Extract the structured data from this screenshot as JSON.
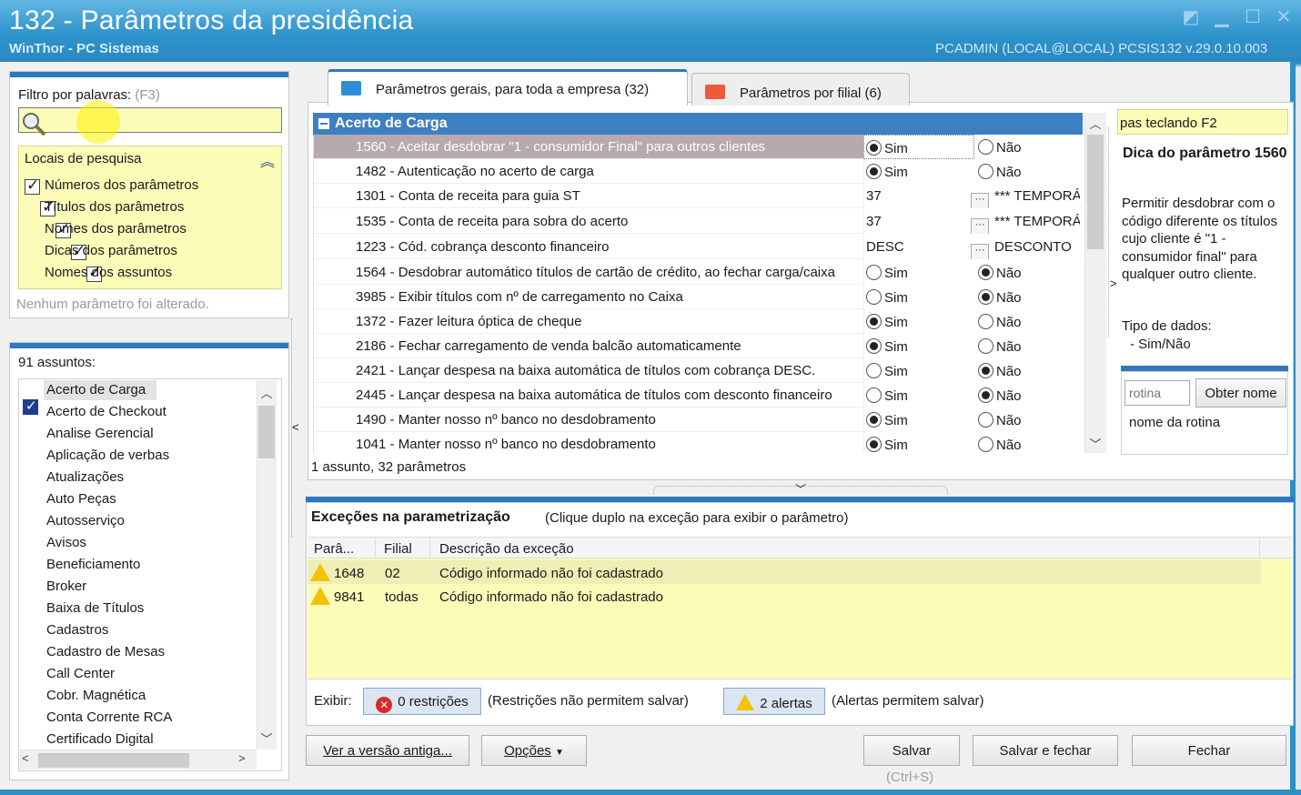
{
  "window": {
    "title": "132 - Parâmetros da presidência",
    "subtitle": "WinThor - PC Sistemas",
    "user_info": "PCADMIN (LOCAL@LOCAL)   PCSIS132  v.29.0.10.003"
  },
  "filter": {
    "label": "Filtro por palavras:",
    "shortcut": "(F3)",
    "value": "",
    "locations_title": "Locais de pesquisa",
    "options": [
      {
        "label": "Números dos parâmetros",
        "checked": true
      },
      {
        "label": "Títulos dos parâmetros",
        "checked": true
      },
      {
        "label": "Nomes dos parâmetros",
        "checked": true
      },
      {
        "label": "Dicas dos parâmetros",
        "checked": true
      },
      {
        "label": "Nomes dos assuntos",
        "checked": true
      }
    ],
    "status": "Nenhum parâmetro foi alterado."
  },
  "subjects": {
    "count_label": "91 assuntos:",
    "items": [
      "Acerto de Carga",
      "Acerto de Checkout",
      "Analise Gerencial",
      "Aplicação de verbas",
      "Atualizações",
      "Auto Peças",
      "Autosserviço",
      "Avisos",
      "Beneficiamento",
      "Broker",
      "Baixa de Títulos",
      "Cadastros",
      "Cadastro de Mesas",
      "Call Center",
      "Cobr. Magnética",
      "Conta Corrente RCA",
      "Certificado Digital"
    ]
  },
  "tabs": [
    {
      "label": "Parâmetros gerais, para toda a empresa  (32)",
      "active": true,
      "color": "#2d8ed8"
    },
    {
      "label": "Parâmetros por filial  (6)",
      "active": false,
      "color": "#ee5a3c"
    }
  ],
  "grid": {
    "group": "Acerto de Carga",
    "rows": [
      {
        "name": "1560 - Aceitar desdobrar \"1 - consumidor Final\" para outros clientes",
        "type": "bool",
        "value": true
      },
      {
        "name": "1482 - Autenticação no acerto de carga",
        "type": "bool",
        "value": true
      },
      {
        "name": "1301 - Conta de receita para guia ST",
        "type": "lookup",
        "code": "37",
        "desc": "*** TEMPORÁRIO"
      },
      {
        "name": "1535 - Conta de receita para sobra do acerto",
        "type": "lookup",
        "code": "37",
        "desc": "*** TEMPORÁRIO"
      },
      {
        "name": "1223 - Cód. cobrança desconto financeiro",
        "type": "lookup",
        "code": "DESC",
        "desc": "DESCONTO"
      },
      {
        "name": "1564 - Desdobrar automático títulos de cartão de crédito, ao fechar carga/caixa",
        "type": "bool",
        "value": false
      },
      {
        "name": "3985 - Exibir títulos com nº de carregamento no Caixa",
        "type": "bool",
        "value": false
      },
      {
        "name": "1372 - Fazer leitura óptica de cheque",
        "type": "bool",
        "value": true
      },
      {
        "name": "2186 - Fechar carregamento de venda balcão automaticamente",
        "type": "bool",
        "value": true
      },
      {
        "name": "2421 - Lançar despesa na baixa automática de títulos com cobrança DESC.",
        "type": "bool",
        "value": false
      },
      {
        "name": "2445 - Lançar despesa na baixa automática de títulos com desconto financeiro",
        "type": "bool",
        "value": false
      },
      {
        "name": "1490 - Manter nosso nº banco no desdobramento",
        "type": "bool",
        "value": true
      },
      {
        "name": "1041 - Manter nosso nº banco no desdobramento",
        "type": "bool",
        "value": true
      }
    ],
    "yes": "Sim",
    "no": "Não",
    "footer": "1 assunto, 32 parâmetros"
  },
  "tip": {
    "search_hint": "pas teclando F2",
    "title": "Dica do parâmetro 1560",
    "text": "Permitir desdobrar com o código diferente os títulos cujo cliente é \"1 - consumidor final\" para qualquer outro cliente.",
    "type_label": "Tipo de dados:",
    "type_value": "- Sim/Não",
    "routine_placeholder": "rotina",
    "get_name_label": "Obter nome",
    "routine_name": "nome da rotina"
  },
  "exceptions": {
    "title": "Exceções na parametrização",
    "hint": "(Clique duplo na exceção para exibir o parâmetro)",
    "columns": [
      "Parâ...",
      "Filial",
      "Descrição da exceção"
    ],
    "rows": [
      {
        "param": "1648",
        "filial": "02",
        "desc": "Código informado não foi cadastrado"
      },
      {
        "param": "9841",
        "filial": "todas",
        "desc": "Código informado não foi cadastrado"
      }
    ],
    "show_label": "Exibir:",
    "restrictions_label": "0 restrições",
    "restrictions_note": "(Restrições não permitem salvar)",
    "alerts_label": "2 alertas",
    "alerts_note": "(Alertas permitem salvar)"
  },
  "buttons": {
    "old_version": "Ver a versão antiga...",
    "options": "Opções",
    "save": "Salvar",
    "save_shortcut": "(Ctrl+S)",
    "save_close": "Salvar e fechar",
    "close": "Fechar"
  }
}
